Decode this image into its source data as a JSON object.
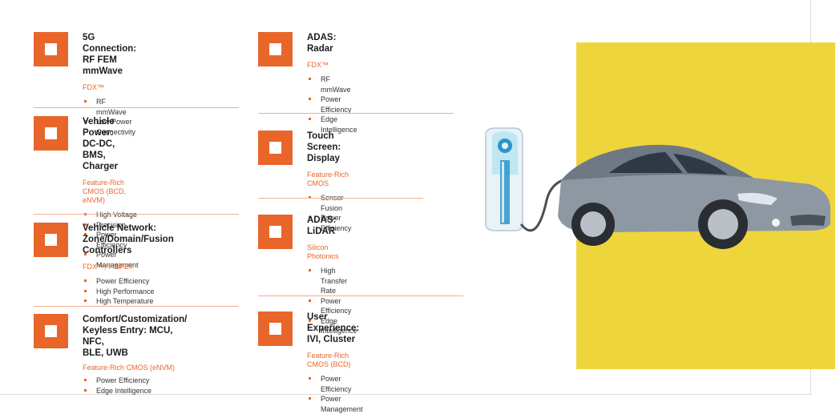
{
  "left_column": [
    {
      "title": "5G Connection:\nRF FEM mmWave",
      "tech": "FDX™",
      "bullets": [
        "RF mmWave",
        "Low Power Connectivity"
      ]
    },
    {
      "title": "Vehicle Power:\nDC-DC, BMS, Charger",
      "tech": "Feature-Rich CMOS (BCD, eNVM)",
      "bullets": [
        "High Voltage",
        "Precision",
        "Power Efficiency",
        "Power Management"
      ]
    },
    {
      "title": "Vehicle Network:\nZone/Domain/Fusion Controllers",
      "tech": "FDX™, FINFET",
      "bullets": [
        "Power Efficiency",
        "High Performance",
        "High Temperature"
      ]
    },
    {
      "title": "Comfort/Customization/\nKeyless Entry: MCU, NFC,\nBLE, UWB",
      "tech": "Feature-Rich CMOS (eNVM)",
      "bullets": [
        "Power Efficiency",
        "Edge Intelligence"
      ]
    }
  ],
  "right_column": [
    {
      "title": "ADAS: Radar",
      "tech": "FDX™",
      "bullets": [
        "RF mmWave",
        "Power Efficiency",
        "Edge Intelligence"
      ]
    },
    {
      "title": "Touch Screen: Display",
      "tech": "Feature-Rich CMOS",
      "bullets": [
        "Sensor Fusion",
        "Power Efficiency"
      ]
    },
    {
      "title": "ADAS: LiDAR",
      "tech": "Silicon Photonics",
      "bullets": [
        "High Transfer Rate",
        "Power Efficiency",
        "Edge Intelligence"
      ]
    },
    {
      "title": "User Experience:\nIVI, Cluster",
      "tech": "Feature-Rich CMOS (BCD)",
      "bullets": [
        "Power Efficiency",
        "Power Management"
      ]
    }
  ],
  "colors": {
    "accent": "#e8662a",
    "background_panel": "#efd53c",
    "divider": "#f2b08c"
  },
  "illustration": {
    "subject": "ev-charging-station-and-car"
  }
}
